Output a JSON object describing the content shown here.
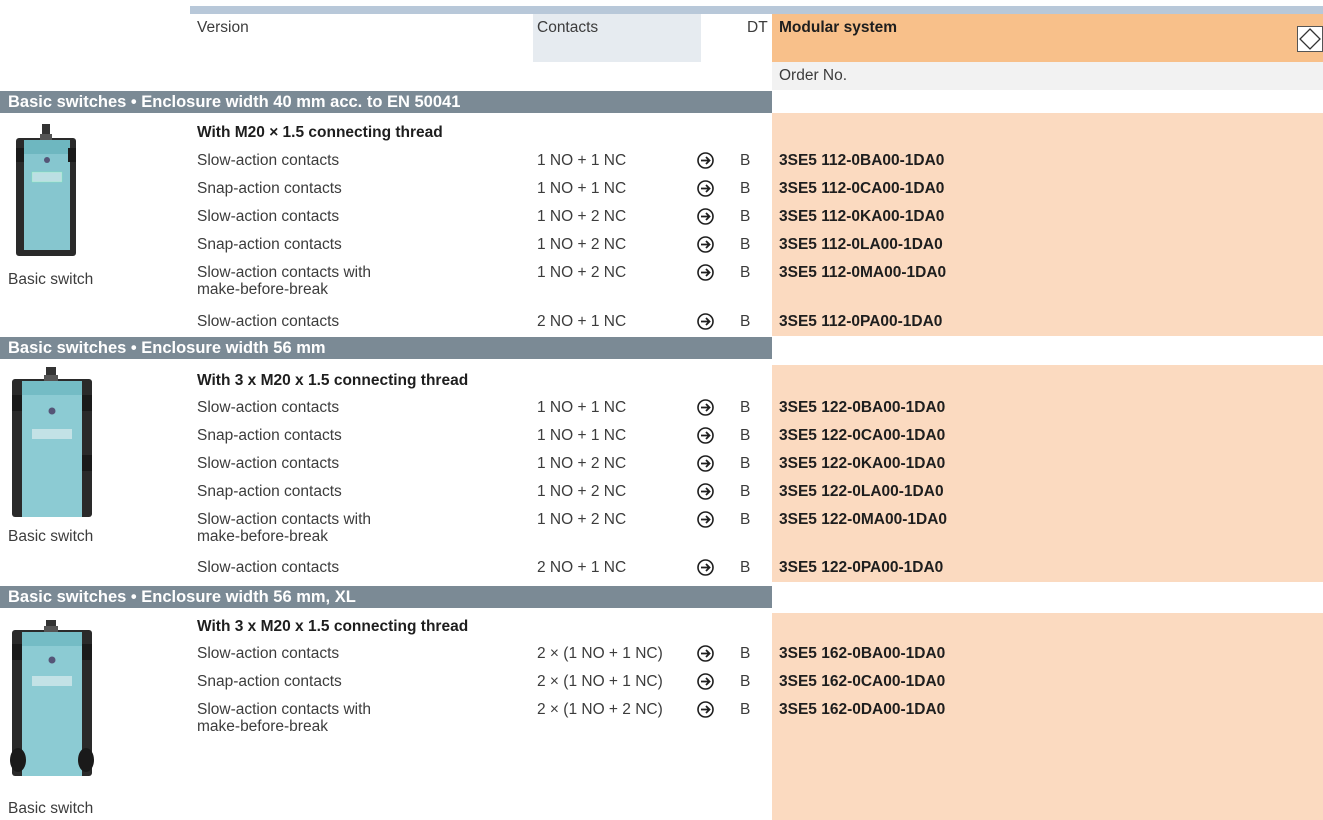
{
  "header": {
    "version": "Version",
    "contacts": "Contacts",
    "dt": "DT",
    "modular_system": "Modular system",
    "order_no": "Order No.",
    "modular_icon": "diamond-arrows-icon"
  },
  "colors": {
    "section_bar": "#7b8a95",
    "top_bar": "#b8c8d9",
    "header_orange": "#f8c08a",
    "order_peach": "#fbdac0"
  },
  "sections": [
    {
      "title": "Basic switches • Enclosure width 40 mm acc. to EN 50041",
      "subtitle": "With M20 × 1.5 connecting thread",
      "image_caption": "Basic switch",
      "rows": [
        {
          "version": "Slow-action contacts",
          "contacts": "1 NO + 1 NC",
          "dt": "B",
          "order": "3SE5 112-0BA00-1DA0"
        },
        {
          "version": "Snap-action contacts",
          "contacts": "1 NO + 1 NC",
          "dt": "B",
          "order": "3SE5 112-0CA00-1DA0"
        },
        {
          "version": "Slow-action contacts",
          "contacts": "1 NO + 2 NC",
          "dt": "B",
          "order": "3SE5 112-0KA00-1DA0"
        },
        {
          "version": "Snap-action contacts",
          "contacts": "1 NO + 2 NC",
          "dt": "B",
          "order": "3SE5 112-0LA00-1DA0"
        },
        {
          "version": "Slow-action contacts with",
          "version2": "make-before-break",
          "contacts": "1 NO + 2 NC",
          "dt": "B",
          "order": "3SE5 112-0MA00-1DA0"
        },
        {
          "version": "Slow-action contacts",
          "contacts": "2 NO + 1 NC",
          "dt": "B",
          "order": "3SE5 112-0PA00-1DA0"
        }
      ]
    },
    {
      "title": "Basic switches • Enclosure width 56 mm",
      "subtitle": "With 3 x M20 x 1.5 connecting thread",
      "image_caption": "Basic switch",
      "rows": [
        {
          "version": "Slow-action contacts",
          "contacts": "1 NO + 1 NC",
          "dt": "B",
          "order": "3SE5 122-0BA00-1DA0"
        },
        {
          "version": "Snap-action contacts",
          "contacts": "1 NO + 1 NC",
          "dt": "B",
          "order": "3SE5 122-0CA00-1DA0"
        },
        {
          "version": "Slow-action contacts",
          "contacts": "1 NO + 2 NC",
          "dt": "B",
          "order": "3SE5 122-0KA00-1DA0"
        },
        {
          "version": "Snap-action contacts",
          "contacts": "1 NO + 2 NC",
          "dt": "B",
          "order": "3SE5 122-0LA00-1DA0"
        },
        {
          "version": "Slow-action contacts with",
          "version2": "make-before-break",
          "contacts": "1 NO + 2 NC",
          "dt": "B",
          "order": "3SE5 122-0MA00-1DA0"
        },
        {
          "version": "Slow-action contacts",
          "contacts": "2 NO + 1 NC",
          "dt": "B",
          "order": "3SE5 122-0PA00-1DA0"
        }
      ]
    },
    {
      "title": "Basic switches • Enclosure width 56 mm, XL",
      "subtitle": "With 3 x M20 x 1.5 connecting thread",
      "image_caption": "Basic switch",
      "rows": [
        {
          "version": "Slow-action contacts",
          "contacts": "2 × (1 NO + 1 NC)",
          "dt": "B",
          "order": "3SE5 162-0BA00-1DA0"
        },
        {
          "version": "Snap-action contacts",
          "contacts": "2 × (1 NO + 1 NC)",
          "dt": "B",
          "order": "3SE5 162-0CA00-1DA0"
        },
        {
          "version": "Slow-action contacts with",
          "version2": "make-before-break",
          "contacts": "2 × (1 NO + 2 NC)",
          "dt": "B",
          "order": "3SE5 162-0DA00-1DA0"
        }
      ]
    }
  ]
}
